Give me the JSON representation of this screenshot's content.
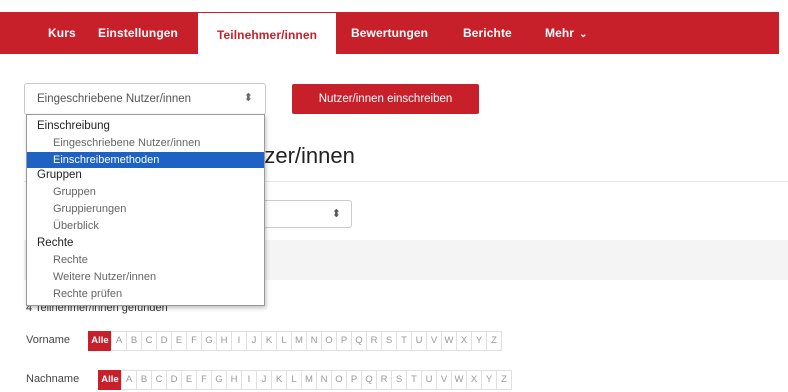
{
  "nav": {
    "items": [
      {
        "label": "Kurs"
      },
      {
        "label": "Einstellungen"
      },
      {
        "label": "Teilnehmer/innen"
      },
      {
        "label": "Bewertungen"
      },
      {
        "label": "Berichte"
      },
      {
        "label": "Mehr"
      }
    ],
    "active": "Teilnehmer/innen"
  },
  "enrol_select": {
    "value": "Eingeschriebene Nutzer/innen",
    "groups": [
      {
        "label": "Einschreibung",
        "options": [
          "Eingeschriebene Nutzer/innen",
          "Einschreibemethoden"
        ]
      },
      {
        "label": "Gruppen",
        "options": [
          "Gruppen",
          "Gruppierungen",
          "Überblick"
        ]
      },
      {
        "label": "Rechte",
        "options": [
          "Rechte",
          "Weitere Nutzer/innen",
          "Rechte prüfen"
        ]
      }
    ],
    "highlighted": "Einschreibemethoden"
  },
  "enrol_button": {
    "label": "Nutzer/innen einschreiben"
  },
  "page_title": "utzer/innen",
  "found_text": "4 Teilnehmer/innen gefunden",
  "initials": {
    "firstname_label": "Vorname",
    "lastname_label": "Nachname",
    "all_label": "Alle",
    "letters": [
      "A",
      "B",
      "C",
      "D",
      "E",
      "F",
      "G",
      "H",
      "I",
      "J",
      "K",
      "L",
      "M",
      "N",
      "O",
      "P",
      "Q",
      "R",
      "S",
      "T",
      "U",
      "V",
      "W",
      "X",
      "Y",
      "Z"
    ]
  },
  "colors": {
    "brand": "#c8202b",
    "highlight": "#1e63c4"
  }
}
